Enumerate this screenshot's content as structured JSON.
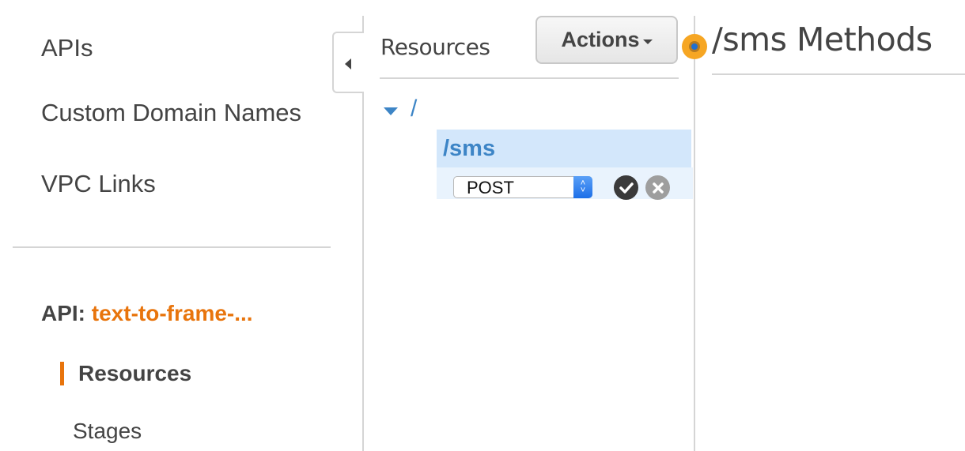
{
  "sidebar": {
    "items": [
      {
        "label": "APIs"
      },
      {
        "label": "Custom Domain Names"
      },
      {
        "label": "VPC Links"
      }
    ],
    "api_prefix": "API:",
    "api_name": "text-to-frame-...",
    "sub_items": [
      {
        "label": "Resources",
        "active": true
      },
      {
        "label": "Stages",
        "active": false
      }
    ]
  },
  "resources_panel": {
    "heading": "Resources",
    "actions_label": "Actions",
    "tree": {
      "root": "/",
      "child": "/sms",
      "method_select_value": "POST"
    }
  },
  "main": {
    "title": "/sms Methods"
  },
  "colors": {
    "accent_orange": "#e8740c",
    "link_blue": "#3d85c6",
    "selected_row": "#d3e7fb"
  }
}
